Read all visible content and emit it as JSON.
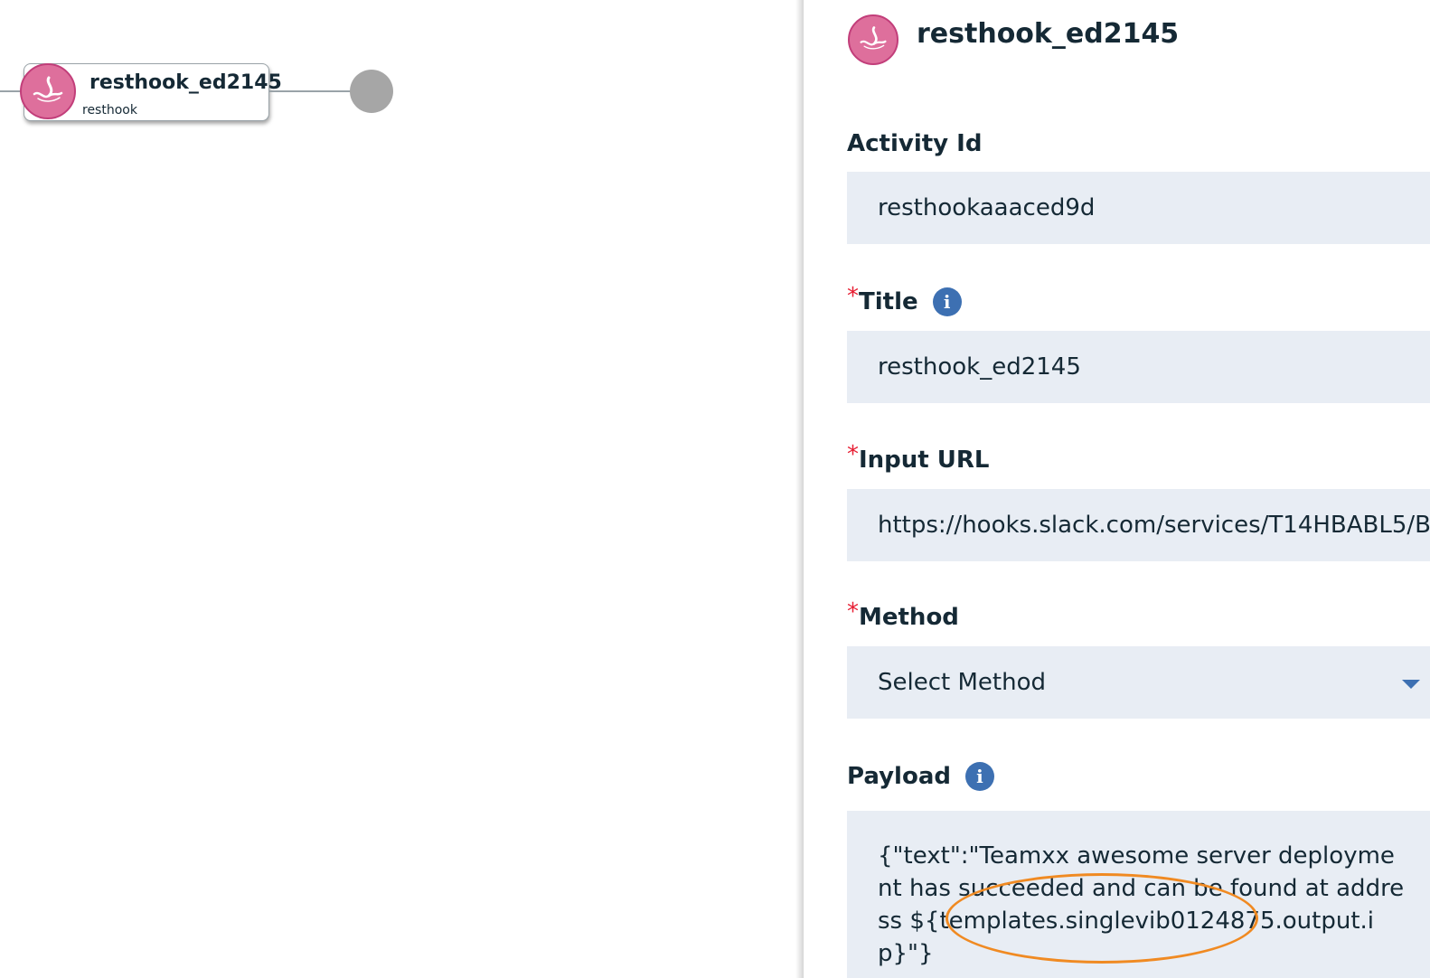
{
  "canvas": {
    "node": {
      "title": "resthook_ed2145",
      "subtitle": "resthook",
      "icon": "resthook-icon"
    }
  },
  "panel": {
    "header_title": "resthook_ed2145",
    "header_icon": "resthook-icon",
    "required_marker": "*",
    "info_glyph": "i",
    "activity_id": {
      "label": "Activity Id",
      "value": "resthookaaaced9d"
    },
    "title_field": {
      "label": "Title",
      "value": "resthook_ed2145"
    },
    "input_url": {
      "label": "Input URL",
      "value": "https://hooks.slack.com/services/T14HBABL5/B"
    },
    "method": {
      "label": "Method",
      "value": "Select Method"
    },
    "payload": {
      "label": "Payload",
      "value": "{\"text\":\"Teamxx awesome server deployment has succeeded and can be found at address ${templates.singlevib0124875.output.ip}\"}"
    }
  },
  "colors": {
    "accent": "#3d70b2",
    "resthook_pink": "#de6f9c",
    "field_bg": "#e8edf4",
    "required": "#e71d32",
    "annotation": "#f08a22"
  }
}
